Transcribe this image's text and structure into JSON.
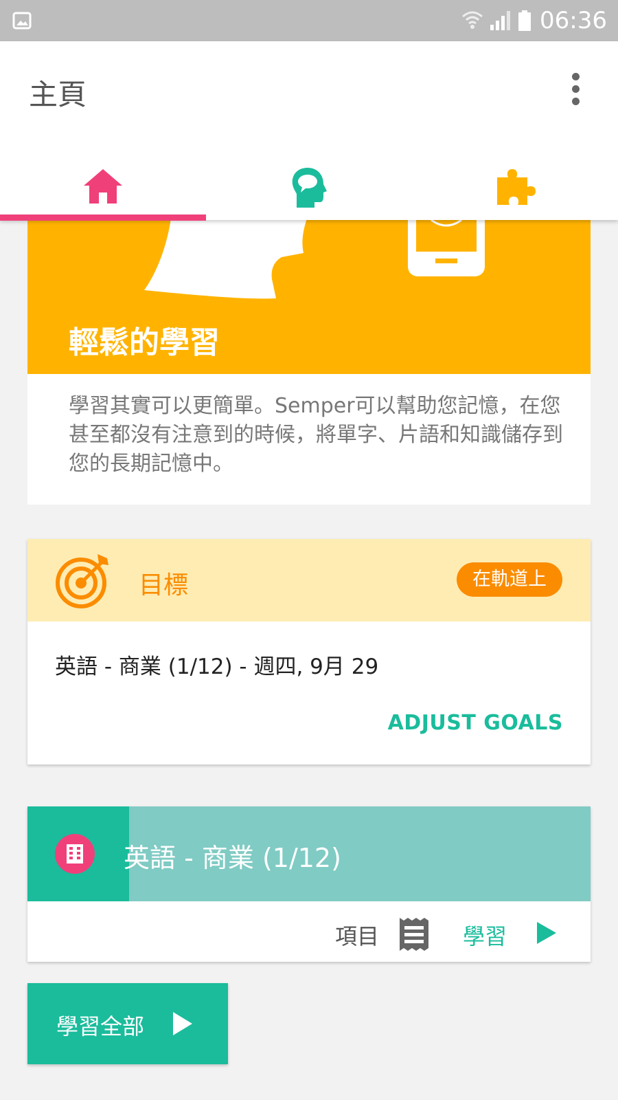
{
  "status_bar": {
    "time": "06:36",
    "icons": [
      "image-icon",
      "wifi-icon",
      "signal-icon",
      "battery-icon"
    ]
  },
  "app_bar": {
    "title": "主頁",
    "menu_icon": "more-vert-icon"
  },
  "tabs": [
    {
      "icon": "home-icon",
      "color": "#f0407a",
      "selected": true
    },
    {
      "icon": "brain-head-icon",
      "color": "#1abc9c",
      "selected": false
    },
    {
      "icon": "puzzle-icon",
      "color": "#ffb300",
      "selected": false
    }
  ],
  "hero": {
    "title": "輕鬆的學習",
    "description": "學習其實可以更簡單。Semper可以幫助您記憶，在您甚至都沒有注意到的時候，將單字、片語和知識儲存到您的長期記憶中。"
  },
  "goals": {
    "title": "目標",
    "badge": "在軌道上",
    "goal_line": "英語 - 商業 (1/12) - 週四, 9月 29",
    "adjust_label": "ADJUST GOALS"
  },
  "course": {
    "title": "英語 - 商業 (1/12)",
    "progress_fraction": 0.18,
    "items_label": "項目",
    "study_label": "學習"
  },
  "study_all": {
    "label": "學習全部"
  },
  "colors": {
    "accent_pink": "#f0407a",
    "teal": "#1abc9c",
    "amber": "#ffb300",
    "orange": "#fb8c00"
  }
}
